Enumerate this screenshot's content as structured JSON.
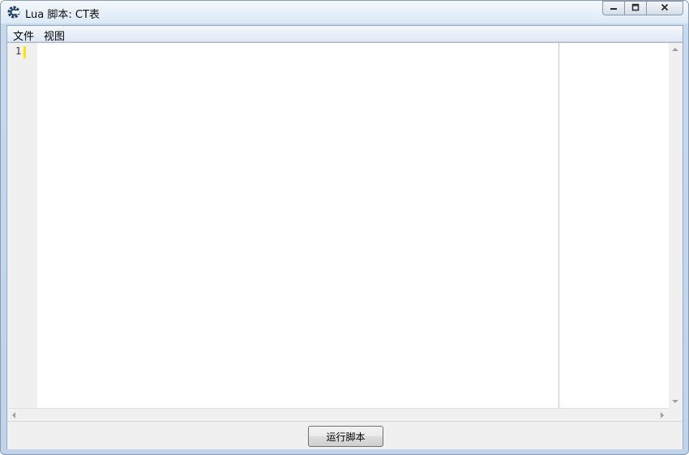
{
  "window": {
    "title": "Lua 脚本: CT表",
    "icon": "cheat-engine-gear-icon",
    "controls": {
      "minimize_icon": "minimize-icon",
      "maximize_icon": "restore-icon",
      "close_icon": "close-icon"
    }
  },
  "menu": {
    "items": [
      {
        "label": "文件"
      },
      {
        "label": "视图"
      }
    ]
  },
  "editor": {
    "line_numbers": [
      "1"
    ],
    "content": "",
    "current_line_color": "#ffe600"
  },
  "footer": {
    "run_button_label": "运行脚本"
  }
}
